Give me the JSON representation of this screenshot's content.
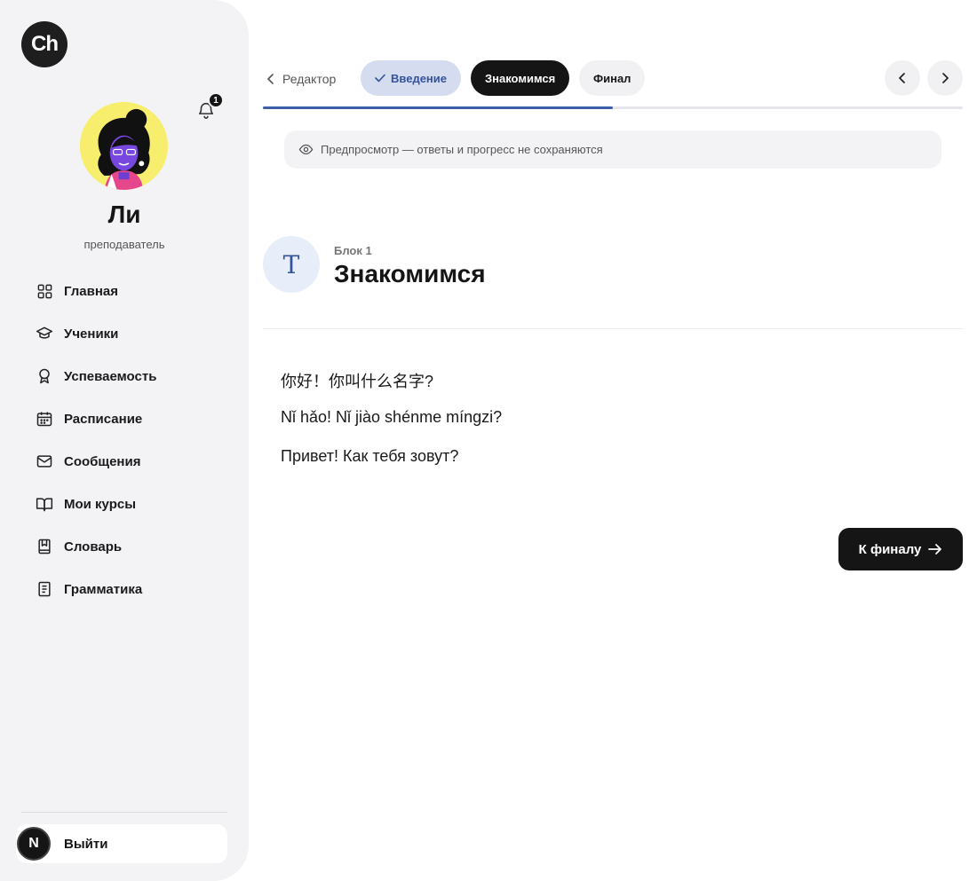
{
  "app": {
    "logo_text": "Ch"
  },
  "notifications": {
    "count": "1"
  },
  "user": {
    "name": "Ли",
    "role": "преподаватель"
  },
  "sidebar": {
    "items": [
      {
        "label": "Главная",
        "icon": "grid-icon"
      },
      {
        "label": "Ученики",
        "icon": "graduation-cap-icon"
      },
      {
        "label": "Успеваемость",
        "icon": "award-icon"
      },
      {
        "label": "Расписание",
        "icon": "calendar-icon"
      },
      {
        "label": "Сообщения",
        "icon": "mail-icon"
      },
      {
        "label": "Мои курсы",
        "icon": "book-open-icon"
      },
      {
        "label": "Словарь",
        "icon": "bookmark-book-icon"
      },
      {
        "label": "Грамматика",
        "icon": "notebook-icon"
      }
    ],
    "logout": {
      "avatar_letter": "N",
      "label": "Выйти"
    }
  },
  "header": {
    "back_label": "Редактор",
    "steps": [
      {
        "label": "Введение",
        "state": "completed"
      },
      {
        "label": "Знакомимся",
        "state": "current"
      },
      {
        "label": "Финал",
        "state": "upcoming"
      }
    ],
    "progress": 0.5
  },
  "preview": {
    "text": "Предпросмотр — ответы и прогресс не сохраняются"
  },
  "block": {
    "icon_letter": "T",
    "number_label": "Блок 1",
    "title": "Знакомимся",
    "phrases": [
      "你好！你叫什么名字?",
      "Nǐ hǎo! Nǐ jiào shénme míngzi?",
      "Привет! Как тебя зовут?"
    ]
  },
  "actions": {
    "next_label": "К финалу"
  },
  "colors": {
    "accent": "#3d5ea8",
    "dark": "#151515",
    "sidebar_bg": "#f3f3f6"
  }
}
